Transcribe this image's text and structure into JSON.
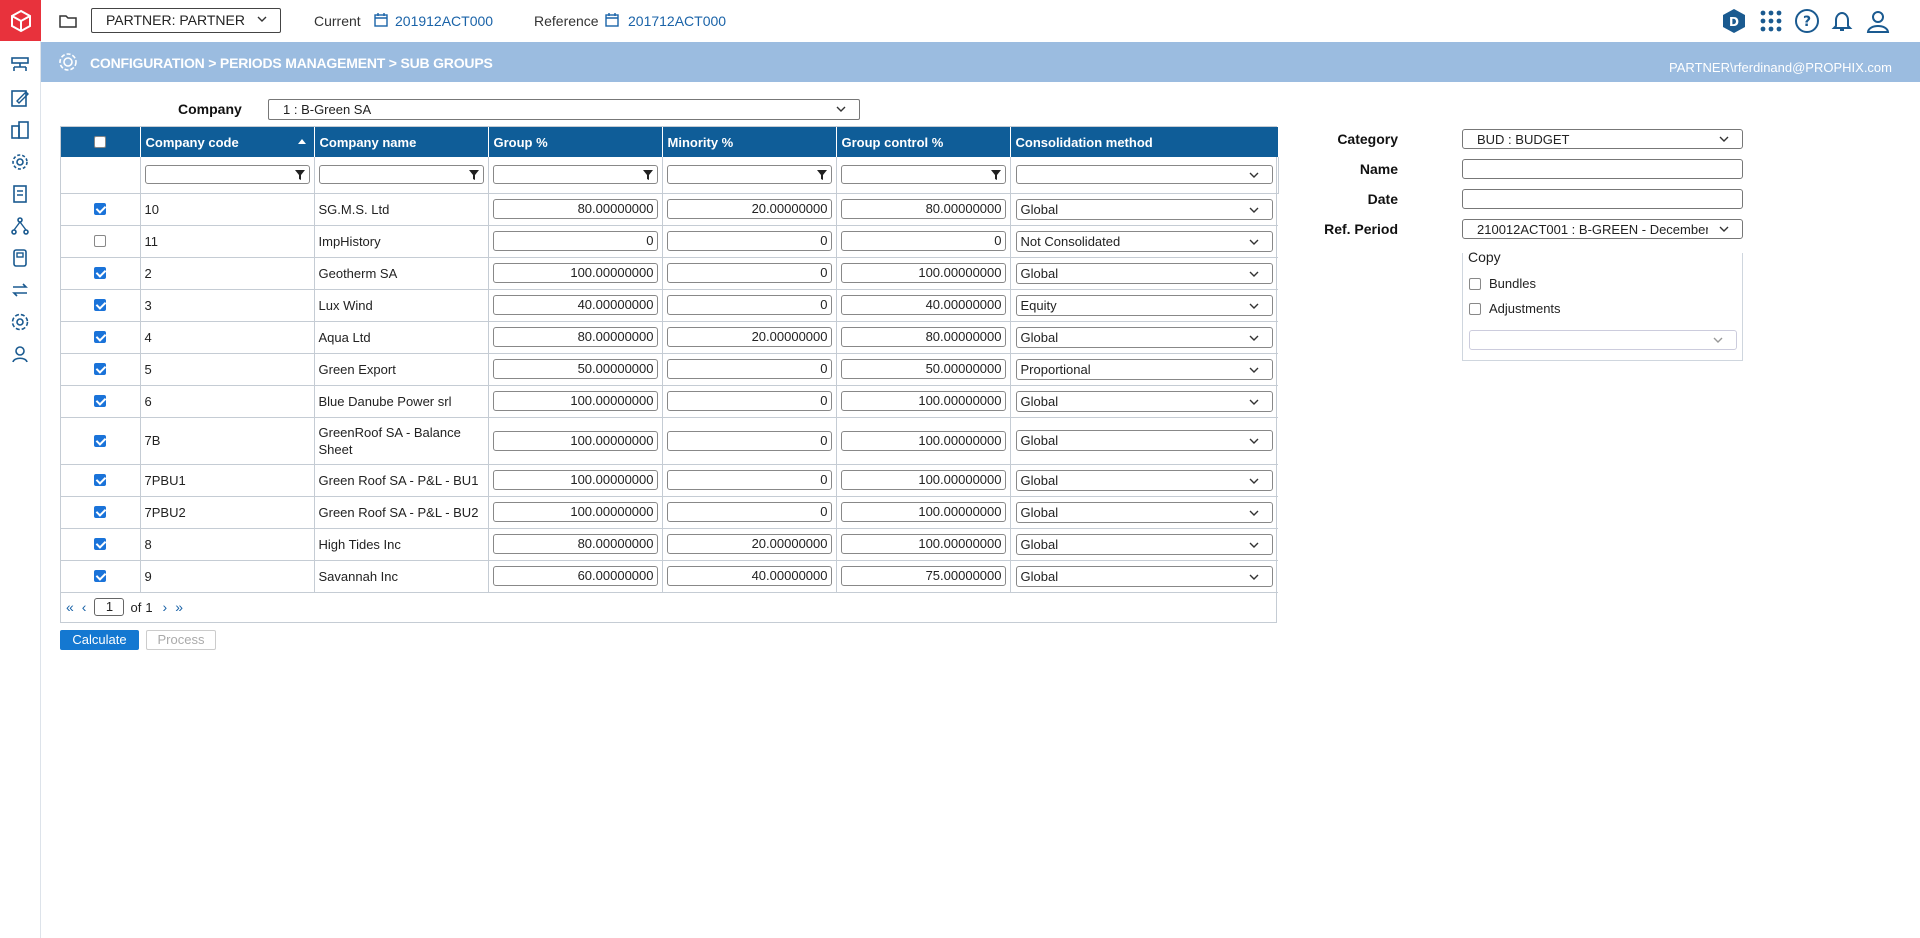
{
  "topbar": {
    "partner_value": "PARTNER: PARTNER",
    "current_label": "Current",
    "current_value": "201912ACT000",
    "reference_label": "Reference",
    "reference_value": "201712ACT000",
    "icons": [
      "d-badge-icon",
      "apps-grid-icon",
      "help-icon",
      "bell-icon",
      "user-icon"
    ]
  },
  "banner": {
    "breadcrumb": "CONFIGURATION > PERIODS MANAGEMENT > SUB GROUPS",
    "user": "PARTNER\\rferdinand@PROPHIX.com"
  },
  "company": {
    "label": "Company",
    "value": "1 : B-Green SA"
  },
  "grid": {
    "columns": [
      "Company code",
      "Company name",
      "Group %",
      "Minority %",
      "Group control %",
      "Consolidation method"
    ],
    "rows": [
      {
        "checked": true,
        "code": "10",
        "name": "SG.M.S. Ltd",
        "group": "80.00000000",
        "minority": "20.00000000",
        "control": "80.00000000",
        "method": "Global"
      },
      {
        "checked": false,
        "code": "11",
        "name": "ImpHistory",
        "group": "0",
        "minority": "0",
        "control": "0",
        "method": "Not Consolidated"
      },
      {
        "checked": true,
        "code": "2",
        "name": "Geotherm SA",
        "group": "100.00000000",
        "minority": "0",
        "control": "100.00000000",
        "method": "Global"
      },
      {
        "checked": true,
        "code": "3",
        "name": "Lux Wind",
        "group": "40.00000000",
        "minority": "0",
        "control": "40.00000000",
        "method": "Equity"
      },
      {
        "checked": true,
        "code": "4",
        "name": "Aqua Ltd",
        "group": "80.00000000",
        "minority": "20.00000000",
        "control": "80.00000000",
        "method": "Global"
      },
      {
        "checked": true,
        "code": "5",
        "name": "Green Export",
        "group": "50.00000000",
        "minority": "0",
        "control": "50.00000000",
        "method": "Proportional"
      },
      {
        "checked": true,
        "code": "6",
        "name": "Blue Danube Power srl",
        "group": "100.00000000",
        "minority": "0",
        "control": "100.00000000",
        "method": "Global"
      },
      {
        "checked": true,
        "code": "7B",
        "name": "GreenRoof SA - Balance Sheet",
        "group": "100.00000000",
        "minority": "0",
        "control": "100.00000000",
        "method": "Global",
        "tall": true
      },
      {
        "checked": true,
        "code": "7PBU1",
        "name": "Green Roof SA - P&L - BU1",
        "group": "100.00000000",
        "minority": "0",
        "control": "100.00000000",
        "method": "Global"
      },
      {
        "checked": true,
        "code": "7PBU2",
        "name": "Green Roof SA - P&L - BU2",
        "group": "100.00000000",
        "minority": "0",
        "control": "100.00000000",
        "method": "Global"
      },
      {
        "checked": true,
        "code": "8",
        "name": "High Tides Inc",
        "group": "80.00000000",
        "minority": "20.00000000",
        "control": "100.00000000",
        "method": "Global"
      },
      {
        "checked": true,
        "code": "9",
        "name": "Savannah Inc",
        "group": "60.00000000",
        "minority": "40.00000000",
        "control": "75.00000000",
        "method": "Global"
      }
    ]
  },
  "pager": {
    "page": "1",
    "of_label": "of",
    "total": "1"
  },
  "actions": {
    "calculate": "Calculate",
    "process": "Process"
  },
  "form": {
    "category_label": "Category",
    "category_value": "BUD : BUDGET",
    "name_label": "Name",
    "name_value": "",
    "date_label": "Date",
    "date_value": "",
    "refperiod_label": "Ref. Period",
    "refperiod_value": "210012ACT001 : B-GREEN - December",
    "copy_title": "Copy",
    "bundles_label": "Bundles",
    "adjustments_label": "Adjustments"
  },
  "colors": {
    "brand": "#e8323c",
    "header": "#0f5d98",
    "banner": "#9bbce0",
    "accent": "#1478d1"
  }
}
